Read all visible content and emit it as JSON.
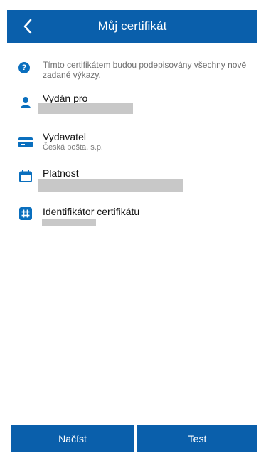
{
  "header": {
    "title": "Můj certifikát"
  },
  "info": {
    "text": "Tímto certifikátem budou podepisovány všechny nově zadané výkazy."
  },
  "items": [
    {
      "label": "Vydán pro",
      "icon": "person-icon"
    },
    {
      "label": "Vydavatel",
      "value": "Česká pošta, s.p.",
      "icon": "card-icon"
    },
    {
      "label": "Platnost",
      "icon": "calendar-icon"
    },
    {
      "label": "Identifikátor certifikátu",
      "icon": "hash-icon"
    }
  ],
  "buttons": {
    "load": "Načíst",
    "test": "Test"
  },
  "colors": {
    "primary": "#0a5fab",
    "icon": "#0a6fbe",
    "redaction": "#c8c8c8"
  }
}
